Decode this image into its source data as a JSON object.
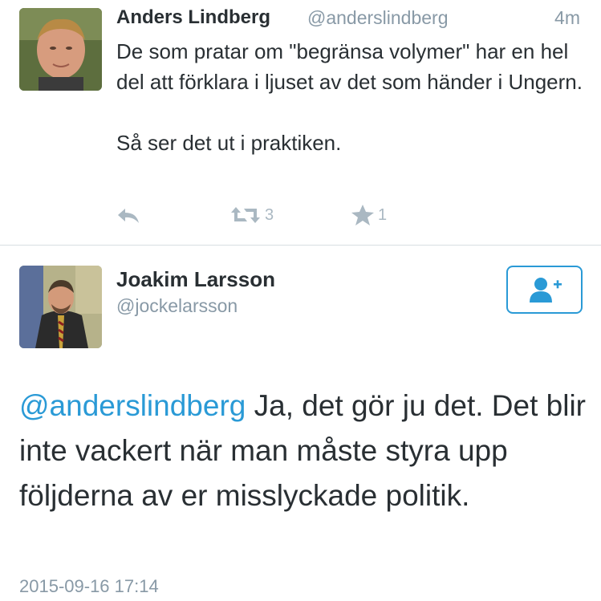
{
  "tweet1": {
    "name": "Anders Lindberg",
    "handle": "@anderslindberg",
    "time": "4m",
    "text_line1": "De som pratar om \"begränsa volymer\" har en hel del att förklara i ljuset av det som händer i Ungern.",
    "text_line2": "Så ser det ut i praktiken.",
    "actions": {
      "reply_icon": "reply-icon",
      "retweet_icon": "retweet-icon",
      "retweet_count": "3",
      "favorite_icon": "star-icon",
      "favorite_count": "1"
    }
  },
  "tweet2": {
    "name": "Joakim Larsson",
    "handle": "@jockelarsson",
    "follow_icon": "follow-user-icon",
    "mention": "@anderslindberg",
    "text": " Ja, det gör ju det. Det blir inte vackert när man måste styra upp följderna av er misslyckade politik.",
    "timestamp": "2015-09-16 17:14"
  },
  "colors": {
    "link": "#2a9ad6",
    "muted": "#8899a6",
    "action": "#aab8c2",
    "text": "#292f33"
  }
}
